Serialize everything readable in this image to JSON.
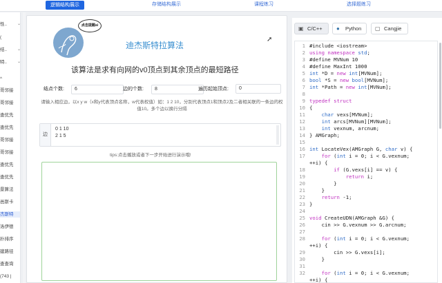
{
  "topbar": {
    "tabs": [
      "逻辑结构展示",
      "存储结构展示",
      "课程练习",
      "选择题练习"
    ]
  },
  "sidebar": {
    "items": [
      "性..",
      "(",
      "结..",
      "特..",
      "",
      "",
      "^",
      "哥邻接",
      "哥邻接",
      "查优先",
      "查优先",
      "哥邻接",
      "哥邻接",
      "查优先",
      "查优先",
      "景算法",
      "邑斯卡",
      "杰斯特",
      "洛伊德",
      "扑排序",
      "建路径",
      "查查询",
      "(743 |"
    ]
  },
  "main": {
    "bubble": "点击提醒ai",
    "title": "迪杰斯特拉算法",
    "subtitle": "该算法是求有向网的v0顶点到其余顶点的最短路径",
    "vertex_label": "结点个数:",
    "vertex_value": "6",
    "edge_label": "边的个数:",
    "edge_value": "8",
    "start_label": "遍历起始顶点:",
    "start_value": "0",
    "hint": "请输入相应边，以x y w（x和y代表顶点名称，w代表权值）如：1 2 10，分别代表顶点1和顶点2及二者相关联的一条边的权值10。多个边以换行分隔",
    "edge_prefix": "边",
    "edge_text": "0 1 10\n2 1 5",
    "tips": "tips:点击播放或者下一步开始进行演示哦!"
  },
  "code_panel": {
    "langs": [
      "C/C++",
      "Python",
      "Cangjie"
    ],
    "lines": [
      {
        "n": "1",
        "t": "#include <iostream>"
      },
      {
        "n": "2",
        "t": "using namespace std;"
      },
      {
        "n": "3",
        "t": "#define MVNum 10"
      },
      {
        "n": "4",
        "t": "#define MaxInt 1000"
      },
      {
        "n": "5",
        "t": "int *D = new int[MVNum];"
      },
      {
        "n": "6",
        "t": "bool *S = new bool[MVNum];"
      },
      {
        "n": "7",
        "t": "int *Path = new int[MVNum];"
      },
      {
        "n": "8",
        "t": ""
      },
      {
        "n": "9",
        "t": "typedef struct"
      },
      {
        "n": "10",
        "t": "{"
      },
      {
        "n": "11",
        "t": "    char vexs[MVNum];"
      },
      {
        "n": "12",
        "t": "    int arcs[MVNum][MVNum];"
      },
      {
        "n": "13",
        "t": "    int vexnum, arcnum;"
      },
      {
        "n": "14",
        "t": "} AMGraph;"
      },
      {
        "n": "15",
        "t": ""
      },
      {
        "n": "16",
        "t": "int LocateVex(AMGraph G, char v) {"
      },
      {
        "n": "17",
        "t": "    for (int i = 0; i < G.vexnum;"
      },
      {
        "n": "",
        "t": "++i) {"
      },
      {
        "n": "18",
        "t": "        if (G.vexs[i] == v) {"
      },
      {
        "n": "19",
        "t": "            return i;"
      },
      {
        "n": "20",
        "t": "        }"
      },
      {
        "n": "21",
        "t": "    }"
      },
      {
        "n": "22",
        "t": "    return -1;"
      },
      {
        "n": "23",
        "t": "}"
      },
      {
        "n": "24",
        "t": ""
      },
      {
        "n": "25",
        "t": "void CreateUDN(AMGraph &G) {"
      },
      {
        "n": "26",
        "t": "    cin >> G.vexnum >> G.arcnum;"
      },
      {
        "n": "27",
        "t": ""
      },
      {
        "n": "28",
        "t": "    for (int i = 0; i < G.vexnum;"
      },
      {
        "n": "",
        "t": "++i) {"
      },
      {
        "n": "29",
        "t": "        cin >> G.vexs[i];"
      },
      {
        "n": "30",
        "t": "    }"
      },
      {
        "n": "31",
        "t": ""
      },
      {
        "n": "32",
        "t": "    for (int i = 0; i < G.vexnum;"
      },
      {
        "n": "",
        "t": "++i) {"
      }
    ]
  }
}
